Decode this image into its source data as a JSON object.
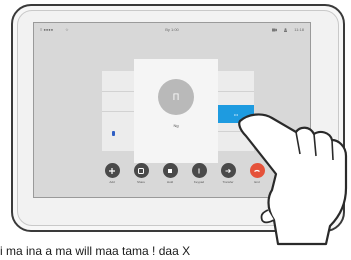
{
  "status_bar": {
    "left_label": "≡ ●●●●",
    "left_secondary": "☆",
    "center_label": "By 1:00",
    "right_time": "11:18"
  },
  "call": {
    "avatar_initial": "Π",
    "name": "Ng"
  },
  "blue_button_label": "•••",
  "controls": [
    {
      "label": "Add",
      "icon": "plus-icon"
    },
    {
      "label": "Share",
      "icon": "share-icon"
    },
    {
      "label": "Hold",
      "icon": "hold-icon"
    },
    {
      "label": "Keypad",
      "icon": "keypad-icon"
    },
    {
      "label": "Transfer",
      "icon": "transfer-icon"
    },
    {
      "label": "End",
      "icon": "end-call-icon"
    }
  ],
  "colors": {
    "accent_blue": "#1e9be0",
    "end_red": "#e5523a",
    "control_dark": "#4a4a4a"
  },
  "bottom_text": "i ma ina a ma will maa tama ! daa X"
}
